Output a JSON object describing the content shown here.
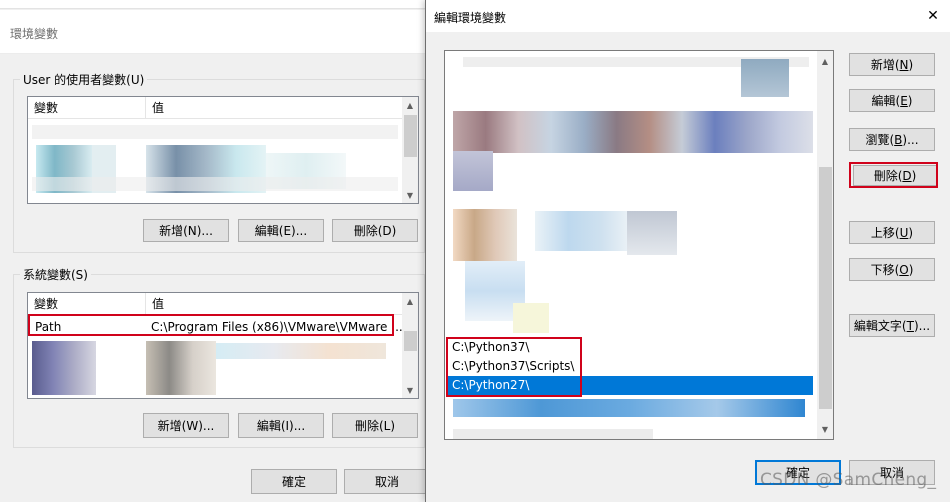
{
  "left_dialog": {
    "title": "環境變數",
    "user_group": {
      "label": "User 的使用者變數(U)",
      "col_var": "變數",
      "col_val": "值",
      "new_btn": "新增(N)...",
      "edit_btn": "編輯(E)...",
      "delete_btn": "刪除(D)"
    },
    "system_group": {
      "label": "系統變數(S)",
      "col_var": "變數",
      "col_val": "值",
      "row_name": "Path",
      "row_value": "C:\\Program Files (x86)\\VMware\\VMware ...",
      "new_btn": "新增(W)...",
      "edit_btn": "編輯(I)...",
      "delete_btn": "刪除(L)"
    },
    "ok_btn": "確定",
    "cancel_btn": "取消"
  },
  "right_dialog": {
    "title": "編輯環境變數",
    "close_glyph": "✕",
    "entries": [
      "C:\\Python37\\",
      "C:\\Python37\\Scripts\\",
      "C:\\Python27\\"
    ],
    "selected_entry": "C:\\Python27\\",
    "buttons": {
      "new": {
        "text": "新增(",
        "key": "N",
        "end": ")"
      },
      "edit": {
        "text": "編輯(",
        "key": "E",
        "end": ")"
      },
      "browse": {
        "text": "瀏覽(",
        "key": "B",
        "end": ")..."
      },
      "delete": {
        "text": "刪除(",
        "key": "D",
        "end": ")"
      },
      "move_up": {
        "text": "上移(",
        "key": "U",
        "end": ")"
      },
      "move_down": {
        "text": "下移(",
        "key": "O",
        "end": ")"
      },
      "edit_text": {
        "text": "編輯文字(",
        "key": "T",
        "end": ")..."
      }
    },
    "ok_btn": "確定",
    "cancel_btn": "取消"
  },
  "watermark": "CSDN @SamCheng_"
}
